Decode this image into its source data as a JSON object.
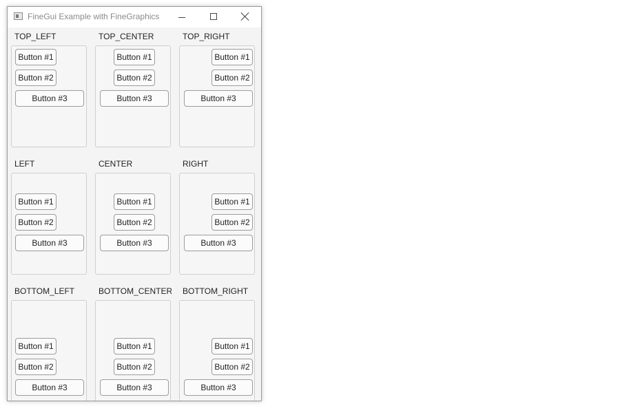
{
  "window": {
    "title": "FineGui Example with FineGraphics",
    "controls": {
      "minimize": "minimize",
      "maximize": "maximize",
      "close": "close"
    }
  },
  "cells": [
    {
      "id": "top-left",
      "label": "TOP_LEFT",
      "buttons": [
        "Button #1",
        "Button #2",
        "Button #3"
      ]
    },
    {
      "id": "top-center",
      "label": "TOP_CENTER",
      "buttons": [
        "Button #1",
        "Button #2",
        "Button #3"
      ]
    },
    {
      "id": "top-right",
      "label": "TOP_RIGHT",
      "buttons": [
        "Button #1",
        "Button #2",
        "Button #3"
      ]
    },
    {
      "id": "left",
      "label": "LEFT",
      "buttons": [
        "Button #1",
        "Button #2",
        "Button #3"
      ]
    },
    {
      "id": "center",
      "label": "CENTER",
      "buttons": [
        "Button #1",
        "Button #2",
        "Button #3"
      ]
    },
    {
      "id": "right",
      "label": "RIGHT",
      "buttons": [
        "Button #1",
        "Button #2",
        "Button #3"
      ]
    },
    {
      "id": "bottom-left",
      "label": "BOTTOM_LEFT",
      "buttons": [
        "Button #1",
        "Button #2",
        "Button #3"
      ]
    },
    {
      "id": "bottom-center",
      "label": "BOTTOM_CENTER",
      "buttons": [
        "Button #1",
        "Button #2",
        "Button #3"
      ]
    },
    {
      "id": "bottom-right",
      "label": "BOTTOM_RIGHT",
      "buttons": [
        "Button #1",
        "Button #2",
        "Button #3"
      ]
    }
  ]
}
